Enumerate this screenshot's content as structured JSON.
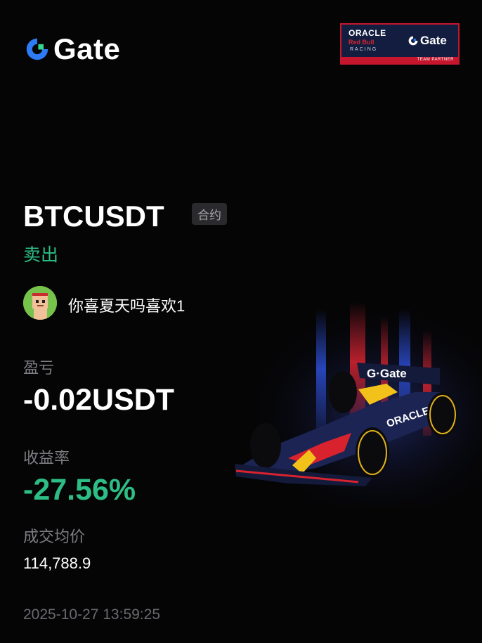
{
  "brand": {
    "name": "Gate",
    "accent": "#2e7bf6"
  },
  "partner_badge": {
    "oracle": "ORACLE",
    "red_bull": "Red Bull",
    "racing": "RACING",
    "gate": "Gate",
    "label": "TEAM PARTNER"
  },
  "trade": {
    "pair": "BTCUSDT",
    "type_tag": "合约",
    "side": "卖出",
    "side_color": "#2dbd85"
  },
  "user": {
    "name": "你喜夏天吗喜欢1",
    "avatar_icon": "pixel-avatar-icon"
  },
  "pnl": {
    "label": "盈亏",
    "value": "-0.02USDT"
  },
  "roi": {
    "label": "收益率",
    "value": "-27.56%",
    "color": "#2dbd85"
  },
  "avg_price": {
    "label": "成交均价",
    "value": "114,788.9"
  },
  "timestamp": "2025-10-27 13:59:25",
  "artwork": {
    "icon": "f1-race-car-icon"
  }
}
